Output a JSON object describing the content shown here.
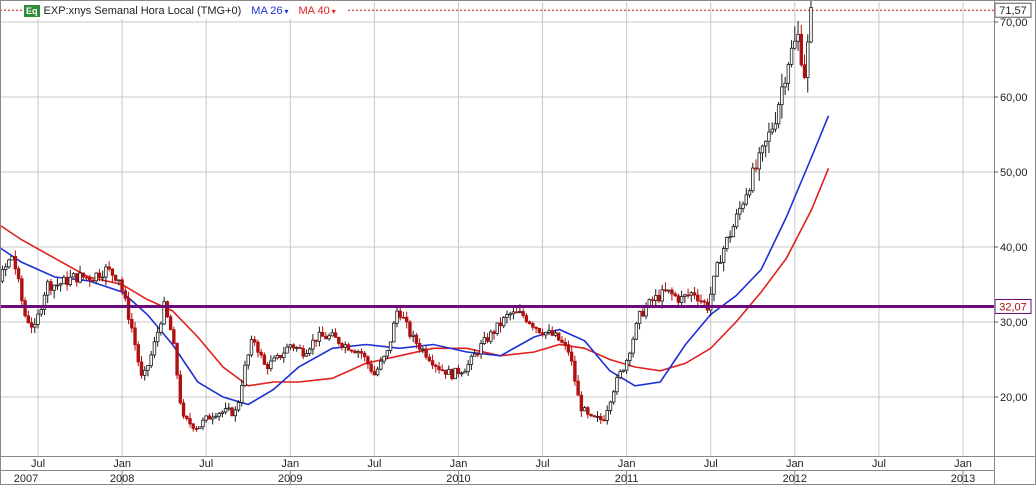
{
  "legend": {
    "badge": "Eq",
    "title": "EXP:xnys Semanal Hora Local (TMG+0)",
    "ma26_label": "MA 26",
    "ma40_label": "MA 40",
    "caret": "▾"
  },
  "colors": {
    "candle_up": "#1a1a1a",
    "candle_down": "#b01010",
    "ma26": "#1f2fd6",
    "ma40": "#e0201e",
    "support_line": "#6b0a78",
    "last_price_line": "#d01515",
    "grid": "#c8c8c8",
    "badge": "#2f8a3a"
  },
  "chart_data": {
    "type": "candlestick",
    "title": "EXP:xnys Semanal Hora Local (TMG+0)",
    "y_ticks": [
      "70,00",
      "60,00",
      "50,00",
      "40,00",
      "30,00",
      "20,00"
    ],
    "y_tick_values": [
      70,
      60,
      50,
      40,
      30,
      20
    ],
    "ylim": [
      12,
      73
    ],
    "month_ticks": [
      {
        "label": "Jul",
        "t": 0.5
      },
      {
        "label": "Jan",
        "t": 1.0
      },
      {
        "label": "Jul",
        "t": 1.5
      },
      {
        "label": "Jan",
        "t": 2.0
      },
      {
        "label": "Jul",
        "t": 2.5
      },
      {
        "label": "Jan",
        "t": 3.0
      },
      {
        "label": "Jul",
        "t": 3.5
      },
      {
        "label": "Jan",
        "t": 4.0
      },
      {
        "label": "Jul",
        "t": 4.5
      },
      {
        "label": "Jan",
        "t": 5.0
      },
      {
        "label": "Jul",
        "t": 5.5
      },
      {
        "label": "Jan",
        "t": 6.0
      }
    ],
    "year_labels": [
      {
        "label": "2007",
        "t": 0.0
      },
      {
        "label": "2008",
        "t": 1.0
      },
      {
        "label": "2009",
        "t": 2.0
      },
      {
        "label": "2010",
        "t": 3.0
      },
      {
        "label": "2011",
        "t": 4.0
      },
      {
        "label": "2012",
        "t": 5.0
      },
      {
        "label": "2013",
        "t": 6.0
      }
    ],
    "xlim": [
      0.0,
      6.12
    ],
    "support_level": {
      "value": 32.07,
      "label": "32,07"
    },
    "last_price": {
      "value": 71.57,
      "label": "71,57"
    },
    "series": [
      {
        "name": "MA 26",
        "period": 26,
        "color": "#1f2fd6"
      },
      {
        "name": "MA 40",
        "period": 40,
        "color": "#e0201e"
      }
    ],
    "price_path": [
      [
        0.0,
        42
      ],
      [
        0.05,
        38
      ],
      [
        0.12,
        36
      ],
      [
        0.2,
        37
      ],
      [
        0.28,
        36
      ],
      [
        0.35,
        39
      ],
      [
        0.42,
        31
      ],
      [
        0.48,
        29
      ],
      [
        0.55,
        35
      ],
      [
        0.62,
        35
      ],
      [
        0.72,
        36
      ],
      [
        0.82,
        36
      ],
      [
        0.9,
        37
      ],
      [
        0.98,
        36
      ],
      [
        1.06,
        29
      ],
      [
        1.12,
        22
      ],
      [
        1.18,
        26
      ],
      [
        1.25,
        32
      ],
      [
        1.3,
        28
      ],
      [
        1.36,
        17
      ],
      [
        1.45,
        16
      ],
      [
        1.55,
        18
      ],
      [
        1.62,
        18
      ],
      [
        1.68,
        18
      ],
      [
        1.72,
        23
      ],
      [
        1.78,
        28
      ],
      [
        1.85,
        24
      ],
      [
        1.92,
        25
      ],
      [
        2.0,
        27
      ],
      [
        2.08,
        26
      ],
      [
        2.16,
        28
      ],
      [
        2.25,
        28
      ],
      [
        2.32,
        27
      ],
      [
        2.42,
        26
      ],
      [
        2.5,
        23
      ],
      [
        2.58,
        26
      ],
      [
        2.64,
        32
      ],
      [
        2.72,
        28
      ],
      [
        2.8,
        26
      ],
      [
        2.88,
        24
      ],
      [
        2.96,
        23
      ],
      [
        3.05,
        24
      ],
      [
        3.14,
        27
      ],
      [
        3.22,
        29
      ],
      [
        3.3,
        31
      ],
      [
        3.38,
        31
      ],
      [
        3.48,
        29
      ],
      [
        3.58,
        28
      ],
      [
        3.66,
        26
      ],
      [
        3.72,
        19
      ],
      [
        3.78,
        17
      ],
      [
        3.86,
        17
      ],
      [
        3.92,
        21
      ],
      [
        4.0,
        25
      ],
      [
        4.08,
        31
      ],
      [
        4.16,
        33
      ],
      [
        4.24,
        34
      ],
      [
        4.32,
        33
      ],
      [
        4.4,
        34
      ],
      [
        4.48,
        32
      ],
      [
        4.56,
        39
      ],
      [
        4.64,
        43
      ],
      [
        4.72,
        48
      ],
      [
        4.8,
        52
      ],
      [
        4.88,
        57
      ],
      [
        4.96,
        65
      ],
      [
        5.02,
        68
      ],
      [
        5.06,
        63
      ],
      [
        5.1,
        71.57
      ]
    ],
    "ma26_path": [
      [
        0.0,
        46
      ],
      [
        0.2,
        41
      ],
      [
        0.4,
        38
      ],
      [
        0.6,
        36
      ],
      [
        0.8,
        35.5
      ],
      [
        1.0,
        34
      ],
      [
        1.15,
        31
      ],
      [
        1.3,
        27
      ],
      [
        1.45,
        22
      ],
      [
        1.6,
        20
      ],
      [
        1.75,
        19
      ],
      [
        1.9,
        21
      ],
      [
        2.05,
        24
      ],
      [
        2.25,
        26.5
      ],
      [
        2.45,
        27
      ],
      [
        2.65,
        26.5
      ],
      [
        2.85,
        27
      ],
      [
        3.05,
        26
      ],
      [
        3.25,
        25.5
      ],
      [
        3.45,
        28
      ],
      [
        3.6,
        29
      ],
      [
        3.75,
        27.5
      ],
      [
        3.9,
        23.5
      ],
      [
        4.05,
        21.5
      ],
      [
        4.2,
        22
      ],
      [
        4.35,
        27
      ],
      [
        4.5,
        31
      ],
      [
        4.65,
        33.5
      ],
      [
        4.8,
        37
      ],
      [
        4.95,
        44
      ],
      [
        5.1,
        52
      ],
      [
        5.2,
        57.5
      ]
    ],
    "ma40_path": [
      [
        0.0,
        45.5
      ],
      [
        0.2,
        44
      ],
      [
        0.4,
        41
      ],
      [
        0.6,
        38.5
      ],
      [
        0.8,
        36
      ],
      [
        1.0,
        35
      ],
      [
        1.15,
        33
      ],
      [
        1.3,
        31.5
      ],
      [
        1.45,
        28
      ],
      [
        1.6,
        24
      ],
      [
        1.75,
        21.5
      ],
      [
        1.9,
        22
      ],
      [
        2.05,
        22
      ],
      [
        2.25,
        22.5
      ],
      [
        2.45,
        24.5
      ],
      [
        2.65,
        25.5
      ],
      [
        2.85,
        26.5
      ],
      [
        3.05,
        26.5
      ],
      [
        3.25,
        25.5
      ],
      [
        3.45,
        26
      ],
      [
        3.6,
        27
      ],
      [
        3.75,
        26.5
      ],
      [
        3.9,
        25
      ],
      [
        4.05,
        24
      ],
      [
        4.2,
        23.5
      ],
      [
        4.35,
        24.5
      ],
      [
        4.5,
        26.5
      ],
      [
        4.65,
        30
      ],
      [
        4.8,
        34
      ],
      [
        4.95,
        38.5
      ],
      [
        5.1,
        45
      ],
      [
        5.2,
        50.5
      ]
    ]
  }
}
